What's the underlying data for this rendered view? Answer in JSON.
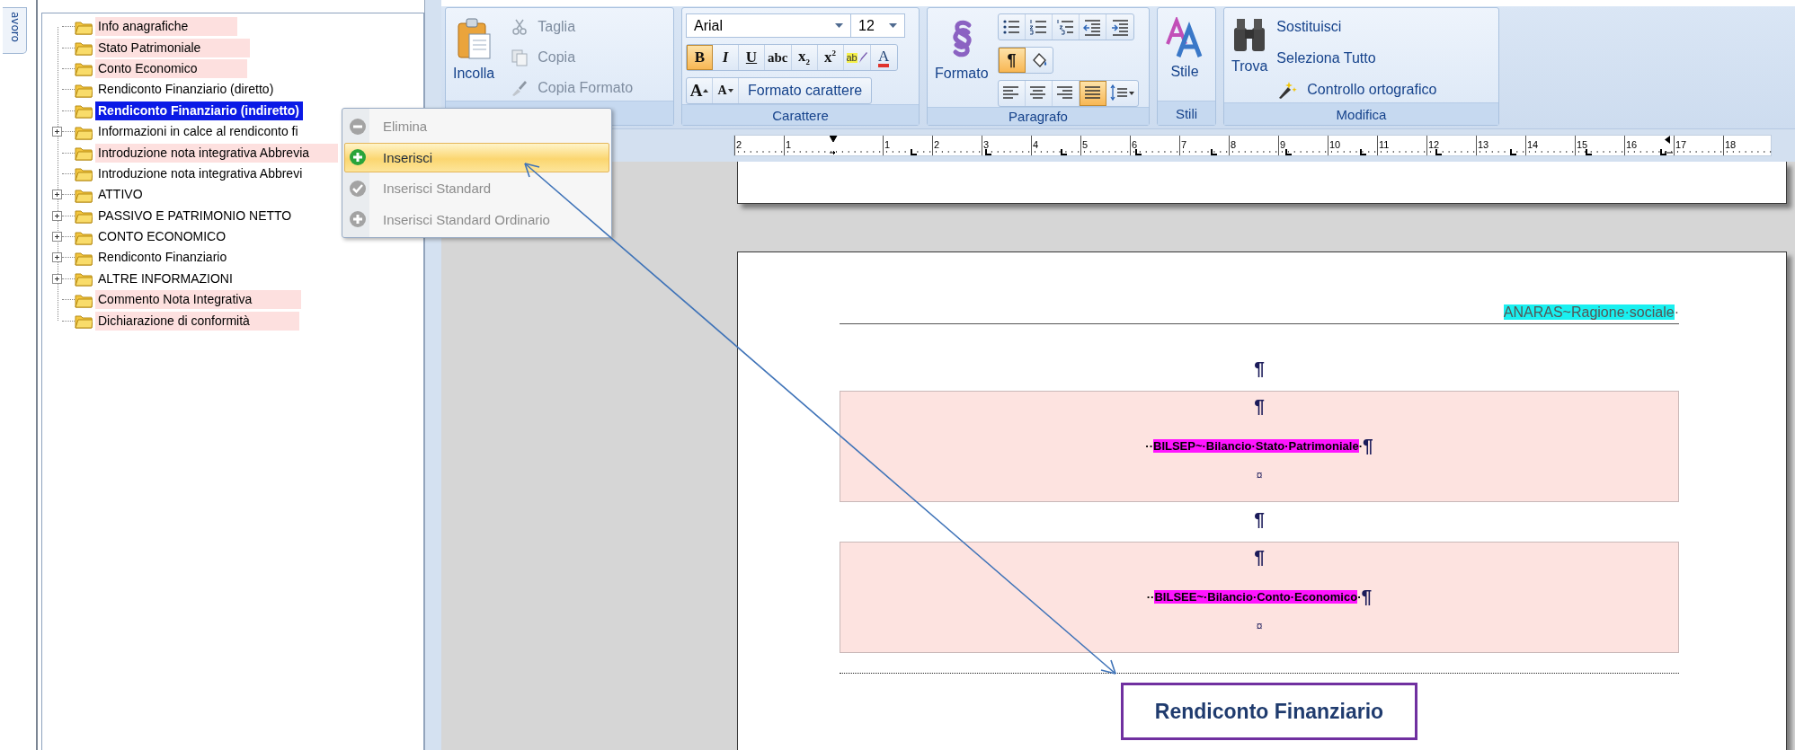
{
  "side_tab": {
    "label": "avoro"
  },
  "tree": {
    "items": [
      {
        "label": "Info anagrafiche",
        "kind": "leaf",
        "highlighted": true,
        "selected": false
      },
      {
        "label": "Stato Patrimoniale",
        "kind": "leaf",
        "highlighted": true,
        "selected": false
      },
      {
        "label": "Conto Economico",
        "kind": "leaf",
        "highlighted": true,
        "selected": false
      },
      {
        "label": "Rendiconto Finanziario (diretto)",
        "kind": "leaf",
        "highlighted": false,
        "selected": false
      },
      {
        "label": "Rendiconto Finanziario (indiretto)",
        "kind": "leaf",
        "highlighted": false,
        "selected": true
      },
      {
        "label": "Informazioni in calce al rendiconto fi",
        "kind": "group",
        "highlighted": false,
        "selected": false
      },
      {
        "label": "Introduzione nota integrativa Abbrevia",
        "kind": "leaf",
        "highlighted": true,
        "selected": false
      },
      {
        "label": "Introduzione nota integrativa Abbrevi",
        "kind": "leaf",
        "highlighted": false,
        "selected": false
      },
      {
        "label": "ATTIVO",
        "kind": "group",
        "highlighted": false,
        "selected": false
      },
      {
        "label": "PASSIVO E PATRIMONIO NETTO",
        "kind": "group",
        "highlighted": false,
        "selected": false
      },
      {
        "label": "CONTO ECONOMICO",
        "kind": "group",
        "highlighted": false,
        "selected": false
      },
      {
        "label": "Rendiconto Finanziario",
        "kind": "group",
        "highlighted": false,
        "selected": false
      },
      {
        "label": "ALTRE INFORMAZIONI",
        "kind": "group",
        "highlighted": false,
        "selected": false
      },
      {
        "label": "Commento Nota Integrativa",
        "kind": "leaf",
        "highlighted": true,
        "selected": false
      },
      {
        "label": "Dichiarazione di conformità",
        "kind": "leaf",
        "highlighted": true,
        "selected": false
      }
    ]
  },
  "context_menu": {
    "items": [
      {
        "label": "Elimina",
        "kind": "remove",
        "disabled": true,
        "selected": false
      },
      {
        "label": "Inserisci",
        "kind": "add",
        "disabled": false,
        "selected": true
      },
      {
        "label": "Inserisci Standard",
        "kind": "check",
        "disabled": true,
        "selected": false
      },
      {
        "label": "Inserisci Standard Ordinario",
        "kind": "add",
        "disabled": true,
        "selected": false
      }
    ]
  },
  "ribbon": {
    "groups": [
      {
        "kind": "clipboard",
        "paste": "Incolla",
        "items": [
          {
            "label": "Taglia",
            "kind": "cut",
            "disabled": true
          },
          {
            "label": "Copia",
            "kind": "copy",
            "disabled": true
          },
          {
            "label": "Copia Formato",
            "kind": "brush",
            "disabled": true
          }
        ]
      },
      {
        "kind": "font",
        "label": "Carattere",
        "font": "Arial",
        "size": "12",
        "dialog": "Formato carattere",
        "buttons": [
          {
            "label": "B",
            "kind": "bold",
            "pressed": true
          },
          {
            "label": "I",
            "kind": "italic",
            "pressed": false
          },
          {
            "label": "U",
            "kind": "underline",
            "pressed": false
          },
          {
            "label": "abc",
            "kind": "strike",
            "pressed": false
          },
          {
            "label": "x$_{2}$",
            "kind": "script",
            "pressed": false
          },
          {
            "label": "x$^{2}$",
            "kind": "script",
            "pressed": false
          },
          {
            "label": "ab",
            "kind": "highlight",
            "pressed": false
          },
          {
            "label": "A",
            "kind": "color",
            "pressed": false
          }
        ],
        "size_buttons": [
          {
            "label": "A",
            "kind": "grow"
          },
          {
            "label": "A",
            "kind": "shrink"
          }
        ]
      },
      {
        "kind": "paragraph",
        "label": "Paragrafo",
        "button": "Formato",
        "rows": [
          [
            {
              "kind": "bullets",
              "pressed": false
            },
            {
              "kind": "numbering",
              "pressed": false
            },
            {
              "kind": "multilevel",
              "pressed": false
            },
            {
              "kind": "outdent",
              "pressed": false
            },
            {
              "kind": "indent",
              "pressed": false
            }
          ],
          [
            {
              "kind": "pilcrow",
              "label": "¶",
              "pressed": true
            },
            {
              "kind": "shading",
              "pressed": false
            }
          ],
          [
            {
              "kind": "align-left",
              "pressed": false
            },
            {
              "kind": "align-center",
              "pressed": false
            },
            {
              "kind": "align-right",
              "pressed": false
            },
            {
              "kind": "justify",
              "pressed": true
            },
            {
              "kind": "line-spacing",
              "pressed": false
            }
          ]
        ]
      },
      {
        "kind": "styles",
        "label": "Stili",
        "button": "Stile"
      },
      {
        "kind": "editing",
        "label": "Modifica",
        "find": "Trova",
        "items": [
          {
            "label": "Sostituisci",
            "kind": "plain"
          },
          {
            "label": "Seleziona Tutto",
            "kind": "plain"
          },
          {
            "label": "Controllo ortografico",
            "kind": "spell"
          }
        ]
      }
    ]
  },
  "ruler": {
    "left_labels": [
      "2",
      "1"
    ],
    "labels": [
      "1",
      "2",
      "3",
      "4",
      "5",
      "6",
      "7",
      "8",
      "9",
      "10",
      "11",
      "12",
      "13",
      "14",
      "15",
      "16",
      "17",
      "18"
    ]
  },
  "document": {
    "header": {
      "field": "ANARAS~Ragione·sociale",
      "trail": "·"
    },
    "body": [
      {
        "kind": "mark",
        "text": "¶"
      },
      {
        "kind": "table",
        "rows": [
          {
            "kind": "mark",
            "text": "¶"
          },
          {
            "kind": "field",
            "lead": "··",
            "field": "BILSEP~·Bilancio·Stato·Patrimoniale",
            "trail": "·",
            "mark": "¶"
          },
          {
            "kind": "cell-end",
            "text": "¤"
          }
        ]
      },
      {
        "kind": "mark",
        "text": "¶"
      },
      {
        "kind": "table",
        "rows": [
          {
            "kind": "mark",
            "text": "¶"
          },
          {
            "kind": "field",
            "lead": "··",
            "field": "BILSEE~·Bilancio·Conto·Economico",
            "trail": "·",
            "mark": "¶"
          },
          {
            "kind": "cell-end",
            "text": "¤"
          }
        ]
      },
      {
        "kind": "rule"
      }
    ]
  },
  "callout": {
    "label": "Rendiconto Finanziario"
  }
}
